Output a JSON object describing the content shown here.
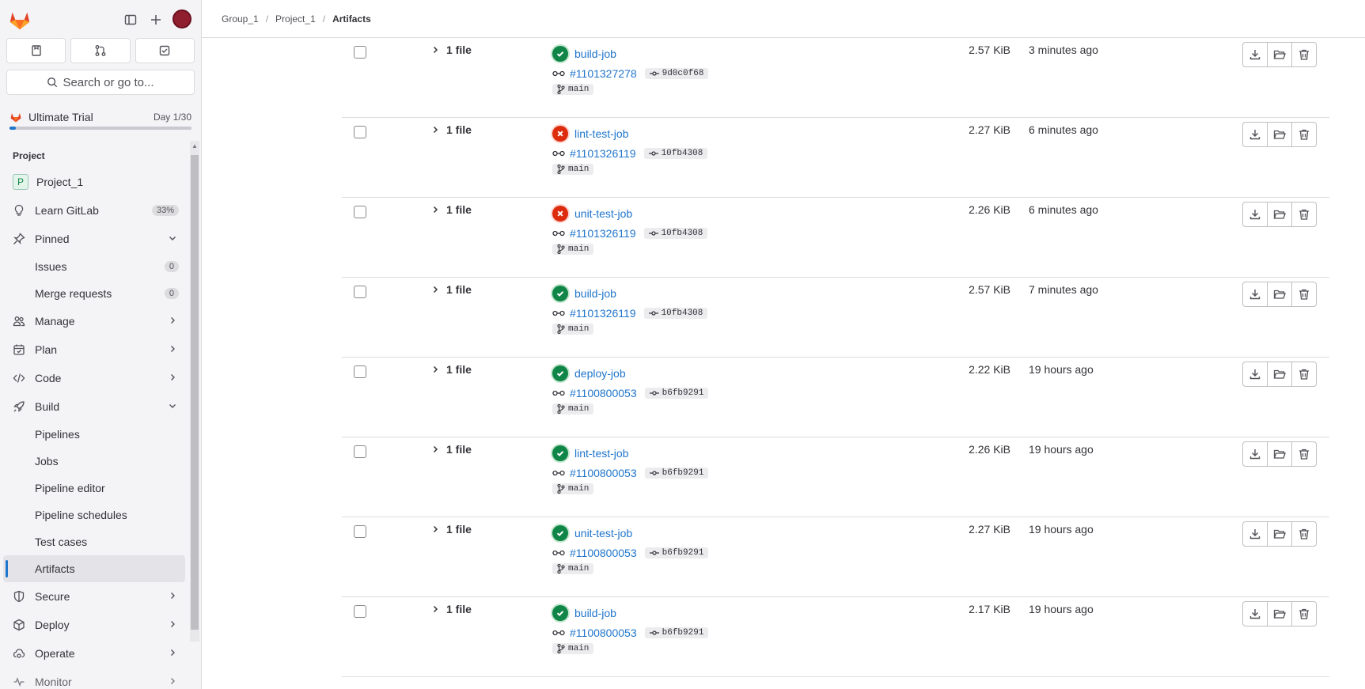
{
  "sidebar": {
    "search_placeholder": "Search or go to...",
    "trial": {
      "label": "Ultimate Trial",
      "day": "Day 1/30",
      "progress": 0.033
    },
    "section": "Project",
    "project": {
      "initial": "P",
      "name": "Project_1"
    },
    "learn": {
      "label": "Learn GitLab",
      "badge": "33%"
    },
    "pinned": {
      "label": "Pinned",
      "issues": "Issues",
      "issues_count": "0",
      "mrs": "Merge requests",
      "mrs_count": "0"
    },
    "manage": "Manage",
    "plan": "Plan",
    "code": "Code",
    "build": "Build",
    "build_items": [
      "Pipelines",
      "Jobs",
      "Pipeline editor",
      "Pipeline schedules",
      "Test cases",
      "Artifacts"
    ],
    "secure": "Secure",
    "deploy": "Deploy",
    "operate": "Operate",
    "monitor": "Monitor"
  },
  "breadcrumb": [
    "Group_1",
    "Project_1",
    "Artifacts"
  ],
  "rows": [
    {
      "files": "1 file",
      "status": "success",
      "job": "build-job",
      "pipeline": "#1101327278",
      "sha": "9d0c0f68",
      "branch": "main",
      "size": "2.57 KiB",
      "time": "3 minutes ago"
    },
    {
      "files": "1 file",
      "status": "failed",
      "job": "lint-test-job",
      "pipeline": "#1101326119",
      "sha": "10fb4308",
      "branch": "main",
      "size": "2.27 KiB",
      "time": "6 minutes ago"
    },
    {
      "files": "1 file",
      "status": "failed",
      "job": "unit-test-job",
      "pipeline": "#1101326119",
      "sha": "10fb4308",
      "branch": "main",
      "size": "2.26 KiB",
      "time": "6 minutes ago"
    },
    {
      "files": "1 file",
      "status": "success",
      "job": "build-job",
      "pipeline": "#1101326119",
      "sha": "10fb4308",
      "branch": "main",
      "size": "2.57 KiB",
      "time": "7 minutes ago"
    },
    {
      "files": "1 file",
      "status": "success",
      "job": "deploy-job",
      "pipeline": "#1100800053",
      "sha": "b6fb9291",
      "branch": "main",
      "size": "2.22 KiB",
      "time": "19 hours ago"
    },
    {
      "files": "1 file",
      "status": "success",
      "job": "lint-test-job",
      "pipeline": "#1100800053",
      "sha": "b6fb9291",
      "branch": "main",
      "size": "2.26 KiB",
      "time": "19 hours ago"
    },
    {
      "files": "1 file",
      "status": "success",
      "job": "unit-test-job",
      "pipeline": "#1100800053",
      "sha": "b6fb9291",
      "branch": "main",
      "size": "2.27 KiB",
      "time": "19 hours ago"
    },
    {
      "files": "1 file",
      "status": "success",
      "job": "build-job",
      "pipeline": "#1100800053",
      "sha": "b6fb9291",
      "branch": "main",
      "size": "2.17 KiB",
      "time": "19 hours ago"
    }
  ],
  "icons": {
    "download": "download-icon",
    "browse": "folder-icon",
    "delete": "trash-icon"
  }
}
